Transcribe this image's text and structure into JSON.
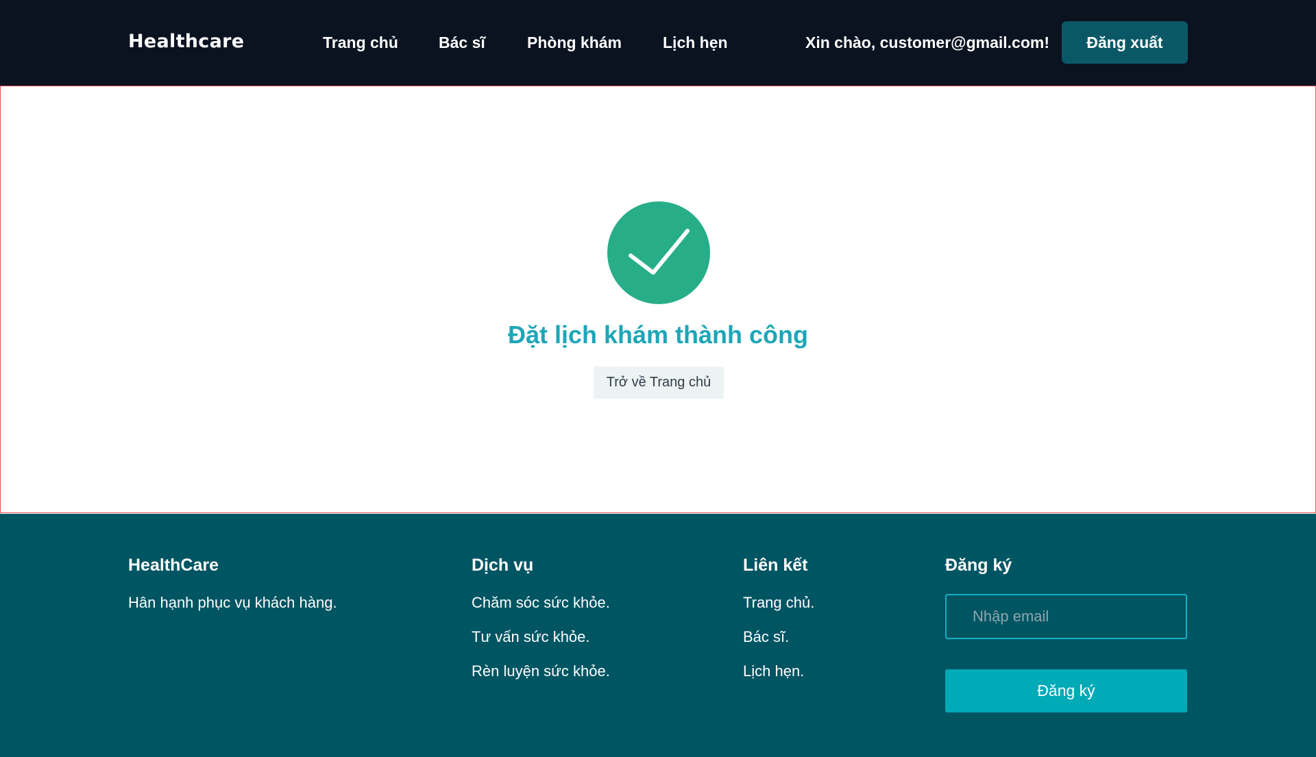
{
  "header": {
    "brand": "Healthcare",
    "nav": [
      {
        "label": "Trang chủ"
      },
      {
        "label": "Bác sĩ"
      },
      {
        "label": "Phòng khám"
      },
      {
        "label": "Lịch hẹn"
      }
    ],
    "greeting": "Xin chào, customer@gmail.com!",
    "logout_label": "Đăng xuất"
  },
  "main": {
    "icon": "check-circle-icon",
    "title": "Đặt lịch khám thành công",
    "home_button_label": "Trở về Trang chủ"
  },
  "footer": {
    "about": {
      "heading": "HealthCare",
      "text": "Hân hạnh phục vụ khách hàng."
    },
    "services": {
      "heading": "Dịch vụ",
      "items": [
        "Chăm sóc sức khỏe.",
        "Tư vấn sức khỏe.",
        "Rèn luyện sức khỏe."
      ]
    },
    "links": {
      "heading": "Liên kết",
      "items": [
        "Trang chủ.",
        "Bác sĩ.",
        "Lịch hẹn."
      ]
    },
    "signup": {
      "heading": "Đăng ký",
      "email_placeholder": "Nhập email",
      "button_label": "Đăng ký"
    }
  },
  "colors": {
    "header_bg": "#0b1220",
    "accent_dark": "#0a5866",
    "success_green": "#27ae89",
    "title_teal": "#1ea6b8",
    "footer_bg": "#005563",
    "signup_button": "#00aab7"
  }
}
